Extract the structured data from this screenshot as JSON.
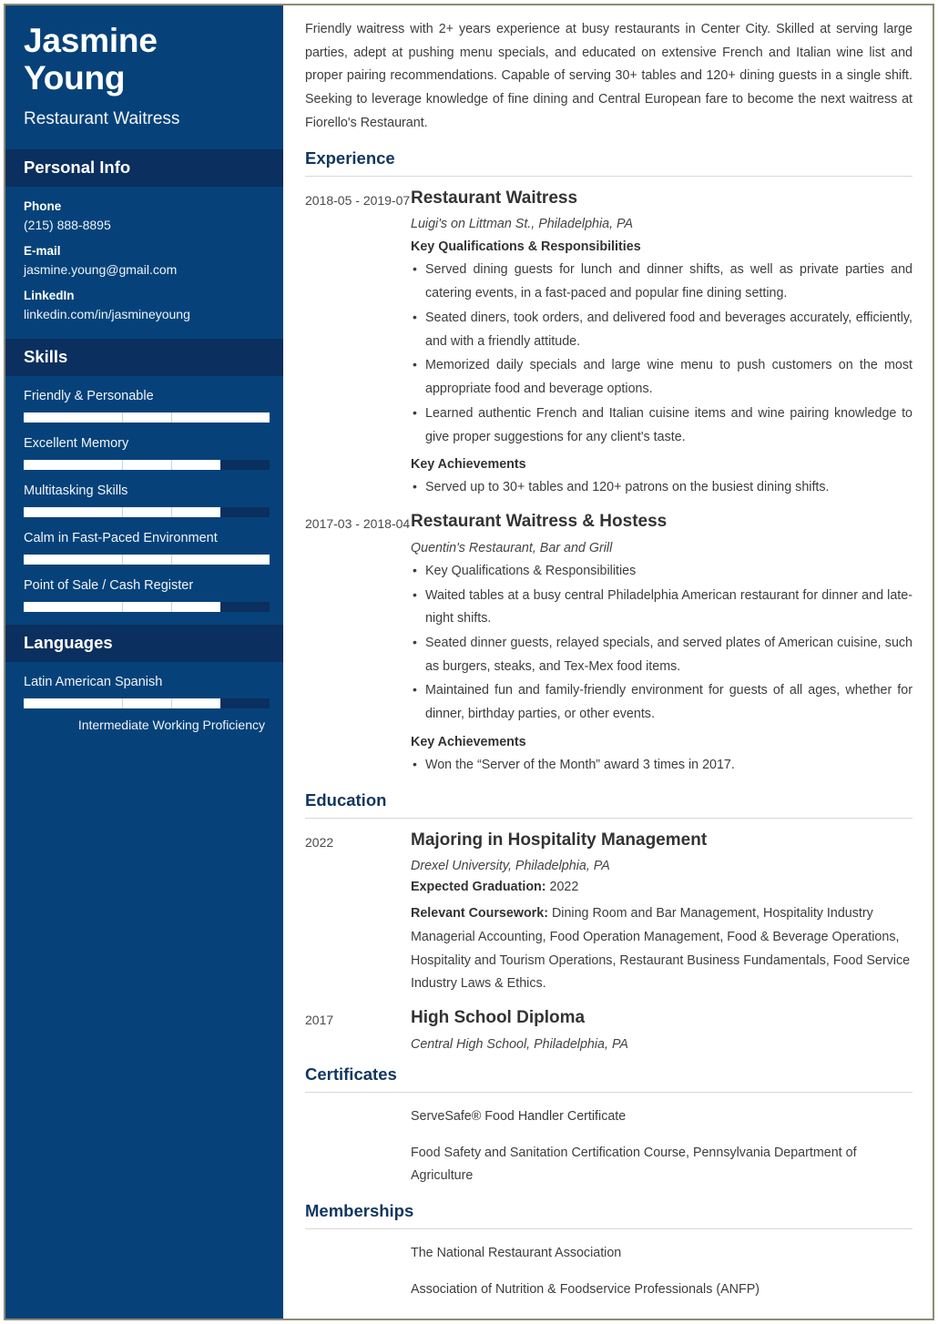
{
  "sidebar": {
    "name": "Jasmine Young",
    "job_title": "Restaurant Waitress",
    "personal_info": {
      "heading": "Personal Info",
      "items": [
        {
          "label": "Phone",
          "value": "(215) 888-8895"
        },
        {
          "label": "E-mail",
          "value": "jasmine.young@gmail.com"
        },
        {
          "label": "LinkedIn",
          "value": "linkedin.com/in/jasmineyoung"
        }
      ]
    },
    "skills": {
      "heading": "Skills",
      "items": [
        {
          "name": "Friendly & Personable",
          "level": 100
        },
        {
          "name": "Excellent Memory",
          "level": 80
        },
        {
          "name": "Multitasking Skills",
          "level": 80
        },
        {
          "name": "Calm in Fast-Paced Environment",
          "level": 100
        },
        {
          "name": "Point of Sale / Cash Register",
          "level": 80
        }
      ]
    },
    "languages": {
      "heading": "Languages",
      "items": [
        {
          "name": "Latin American Spanish",
          "level": 80,
          "note": "Intermediate Working Proficiency"
        }
      ]
    },
    "colors": {
      "sidebar_bg": "#064279",
      "sidebar_header_bg": "#0b2f5e",
      "bar_fill": "#ffffff",
      "bar_track": "#0b2f5e"
    }
  },
  "main": {
    "summary": "Friendly waitress with 2+ years experience at busy restaurants in Center City. Skilled at serving large parties, adept at pushing menu specials, and educated on extensive French and Italian wine list and proper pairing recommendations. Capable of serving 30+ tables and 120+ dining guests in a single shift. Seeking to leverage knowledge of fine dining and Central European fare to become the next waitress at Fiorello's Restaurant.",
    "experience": {
      "heading": "Experience",
      "entries": [
        {
          "date": "2018-05 - 2019-07",
          "role": "Restaurant Waitress",
          "org": "Luigi's on Littman St., Philadelphia, PA",
          "quals_heading": "Key Qualifications & Responsibilities",
          "quals": [
            "Served dining guests for lunch and dinner shifts, as well as private parties and catering events, in a fast-paced and popular fine dining setting.",
            "Seated diners, took orders, and delivered food and beverages accurately, efficiently, and with a friendly attitude.",
            "Memorized daily specials and large wine menu to push customers on the most appropriate food and beverage options.",
            "Learned authentic French and Italian cuisine items and wine pairing knowledge to give proper suggestions for any client's taste."
          ],
          "ach_heading": "Key Achievements",
          "achievements": [
            "Served up to 30+ tables and 120+ patrons on the busiest dining shifts."
          ]
        },
        {
          "date": "2017-03 - 2018-04",
          "role": "Restaurant Waitress & Hostess",
          "org": "Quentin's Restaurant, Bar and Grill",
          "quals_heading": "",
          "quals": [
            "Key Qualifications & Responsibilities",
            "Waited tables at a busy central Philadelphia American restaurant for dinner and late-night shifts.",
            "Seated dinner guests, relayed specials, and served plates of American cuisine, such as burgers, steaks, and Tex-Mex food items.",
            "Maintained fun and family-friendly environment for guests of all ages, whether for dinner, birthday parties, or other events."
          ],
          "ach_heading": "Key Achievements",
          "achievements": [
            "Won the “Server of the Month” award 3 times in 2017."
          ]
        }
      ]
    },
    "education": {
      "heading": "Education",
      "entries": [
        {
          "date": "2022",
          "degree": "Majoring in Hospitality Management",
          "school": "Drexel University, Philadelphia, PA",
          "grad_label": "Expected Graduation:",
          "grad_value": " 2022",
          "course_label": "Relevant Coursework:",
          "course_value": " Dining Room and Bar Management, Hospitality Industry Managerial Accounting, Food Operation Management, Food & Beverage Operations, Hospitality and Tourism Operations, Restaurant Business Fundamentals, Food Service Industry Laws & Ethics."
        },
        {
          "date": "2017",
          "degree": "High School Diploma",
          "school": "Central High School, Philadelphia, PA",
          "grad_label": "",
          "grad_value": "",
          "course_label": "",
          "course_value": ""
        }
      ]
    },
    "certificates": {
      "heading": "Certificates",
      "items": [
        "ServeSafe® Food Handler Certificate",
        "Food Safety and Sanitation Certification Course, Pennsylvania Department of Agriculture"
      ]
    },
    "memberships": {
      "heading": "Memberships",
      "items": [
        "The National Restaurant Association",
        "Association of Nutrition & Foodservice Professionals (ANFP)"
      ]
    }
  }
}
